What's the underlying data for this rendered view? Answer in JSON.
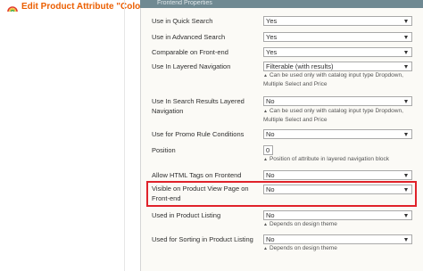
{
  "header": {
    "title": "Edit Product Attribute \"Color\""
  },
  "panel": {
    "heading": "Frontend Properties"
  },
  "rows": [
    {
      "label": "Use in Quick Search",
      "value": "Yes"
    },
    {
      "label": "Use in Advanced Search",
      "value": "Yes"
    },
    {
      "label": "Comparable on Front-end",
      "value": "Yes"
    },
    {
      "label": "Use In Layered Navigation",
      "value": "Filterable (with results)",
      "note": "Can be used only with catalog input type Dropdown, Multiple Select and Price"
    },
    {
      "label": "Use In Search Results Layered Navigation",
      "value": "No",
      "note": "Can be used only with catalog input type Dropdown, Multiple Select and Price"
    },
    {
      "label": "Use for Promo Rule Conditions",
      "value": "No"
    },
    {
      "label": "Position",
      "value": "0",
      "note": "Position of attribute in layered navigation block"
    },
    {
      "label": "Allow HTML Tags on Frontend",
      "value": "No"
    },
    {
      "label": "Visible on Product View Page on Front-end",
      "value": "No"
    },
    {
      "label": "Used in Product Listing",
      "value": "No",
      "note": "Depends on design theme"
    },
    {
      "label": "Used for Sorting in Product Listing",
      "value": "No",
      "note": "Depends on design theme"
    }
  ],
  "notes_split": {
    "layered_line1": "Can be used only with catalog input type Dropdown,",
    "layered_line2": "Multiple Select and Price"
  },
  "labels_split": {
    "search_results_line1": "Use In Search Results Layered",
    "search_results_line2": "Navigation",
    "visible_line1": "Visible on Product View Page on",
    "visible_line2": "Front-end"
  },
  "colors": {
    "title": "#eb5e00",
    "highlight": "#e0222a",
    "panel_head": "#6f8992"
  },
  "icons": {
    "header_icon": "rainbow-icon"
  }
}
